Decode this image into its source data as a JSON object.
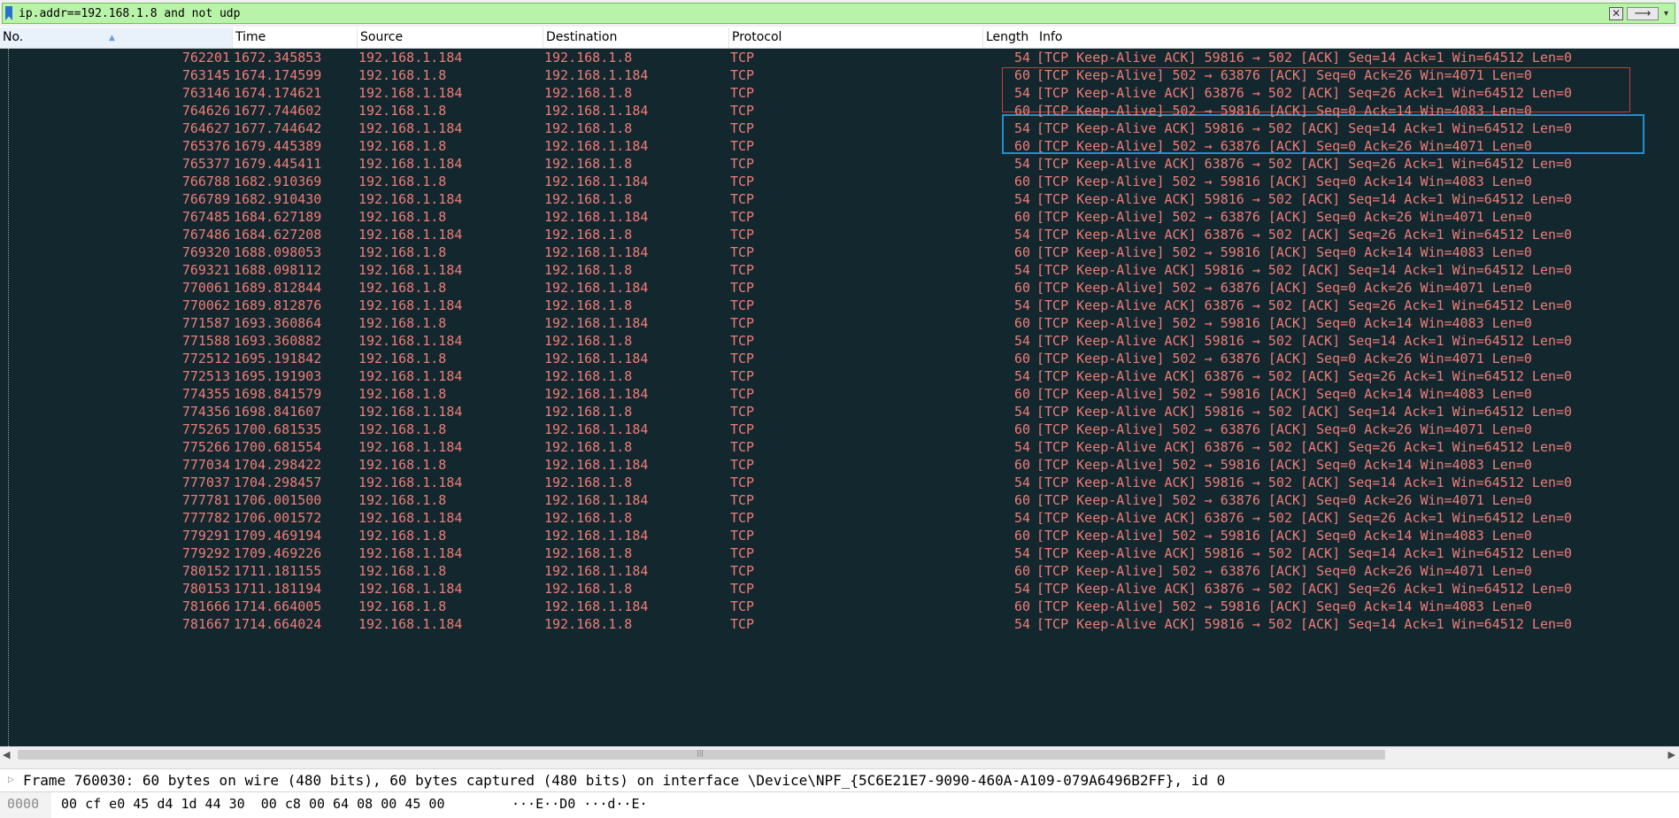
{
  "filter": {
    "value": "ip.addr==192.168.1.8 and not udp"
  },
  "columns": {
    "no": "No.",
    "time": "Time",
    "source": "Source",
    "destination": "Destination",
    "protocol": "Protocol",
    "length": "Length",
    "info": "Info"
  },
  "packets": [
    {
      "no": "762201",
      "time": "1672.345853",
      "source": "192.168.1.184",
      "destination": "192.168.1.8",
      "protocol": "TCP",
      "length": "54",
      "info": "[TCP Keep-Alive ACK] 59816 → 502 [ACK] Seq=14 Ack=1 Win=64512 Len=0"
    },
    {
      "no": "763145",
      "time": "1674.174599",
      "source": "192.168.1.8",
      "destination": "192.168.1.184",
      "protocol": "TCP",
      "length": "60",
      "info": "[TCP Keep-Alive] 502 → 63876 [ACK] Seq=0 Ack=26 Win=4071 Len=0"
    },
    {
      "no": "763146",
      "time": "1674.174621",
      "source": "192.168.1.184",
      "destination": "192.168.1.8",
      "protocol": "TCP",
      "length": "54",
      "info": "[TCP Keep-Alive ACK] 63876 → 502 [ACK] Seq=26 Ack=1 Win=64512 Len=0"
    },
    {
      "no": "764626",
      "time": "1677.744602",
      "source": "192.168.1.8",
      "destination": "192.168.1.184",
      "protocol": "TCP",
      "length": "60",
      "info": "[TCP Keep-Alive] 502 → 59816 [ACK] Seq=0 Ack=14 Win=4083 Len=0"
    },
    {
      "no": "764627",
      "time": "1677.744642",
      "source": "192.168.1.184",
      "destination": "192.168.1.8",
      "protocol": "TCP",
      "length": "54",
      "info": "[TCP Keep-Alive ACK] 59816 → 502 [ACK] Seq=14 Ack=1 Win=64512 Len=0"
    },
    {
      "no": "765376",
      "time": "1679.445389",
      "source": "192.168.1.8",
      "destination": "192.168.1.184",
      "protocol": "TCP",
      "length": "60",
      "info": "[TCP Keep-Alive] 502 → 63876 [ACK] Seq=0 Ack=26 Win=4071 Len=0"
    },
    {
      "no": "765377",
      "time": "1679.445411",
      "source": "192.168.1.184",
      "destination": "192.168.1.8",
      "protocol": "TCP",
      "length": "54",
      "info": "[TCP Keep-Alive ACK] 63876 → 502 [ACK] Seq=26 Ack=1 Win=64512 Len=0"
    },
    {
      "no": "766788",
      "time": "1682.910369",
      "source": "192.168.1.8",
      "destination": "192.168.1.184",
      "protocol": "TCP",
      "length": "60",
      "info": "[TCP Keep-Alive] 502 → 59816 [ACK] Seq=0 Ack=14 Win=4083 Len=0"
    },
    {
      "no": "766789",
      "time": "1682.910430",
      "source": "192.168.1.184",
      "destination": "192.168.1.8",
      "protocol": "TCP",
      "length": "54",
      "info": "[TCP Keep-Alive ACK] 59816 → 502 [ACK] Seq=14 Ack=1 Win=64512 Len=0"
    },
    {
      "no": "767485",
      "time": "1684.627189",
      "source": "192.168.1.8",
      "destination": "192.168.1.184",
      "protocol": "TCP",
      "length": "60",
      "info": "[TCP Keep-Alive] 502 → 63876 [ACK] Seq=0 Ack=26 Win=4071 Len=0"
    },
    {
      "no": "767486",
      "time": "1684.627208",
      "source": "192.168.1.184",
      "destination": "192.168.1.8",
      "protocol": "TCP",
      "length": "54",
      "info": "[TCP Keep-Alive ACK] 63876 → 502 [ACK] Seq=26 Ack=1 Win=64512 Len=0"
    },
    {
      "no": "769320",
      "time": "1688.098053",
      "source": "192.168.1.8",
      "destination": "192.168.1.184",
      "protocol": "TCP",
      "length": "60",
      "info": "[TCP Keep-Alive] 502 → 59816 [ACK] Seq=0 Ack=14 Win=4083 Len=0"
    },
    {
      "no": "769321",
      "time": "1688.098112",
      "source": "192.168.1.184",
      "destination": "192.168.1.8",
      "protocol": "TCP",
      "length": "54",
      "info": "[TCP Keep-Alive ACK] 59816 → 502 [ACK] Seq=14 Ack=1 Win=64512 Len=0"
    },
    {
      "no": "770061",
      "time": "1689.812844",
      "source": "192.168.1.8",
      "destination": "192.168.1.184",
      "protocol": "TCP",
      "length": "60",
      "info": "[TCP Keep-Alive] 502 → 63876 [ACK] Seq=0 Ack=26 Win=4071 Len=0"
    },
    {
      "no": "770062",
      "time": "1689.812876",
      "source": "192.168.1.184",
      "destination": "192.168.1.8",
      "protocol": "TCP",
      "length": "54",
      "info": "[TCP Keep-Alive ACK] 63876 → 502 [ACK] Seq=26 Ack=1 Win=64512 Len=0"
    },
    {
      "no": "771587",
      "time": "1693.360864",
      "source": "192.168.1.8",
      "destination": "192.168.1.184",
      "protocol": "TCP",
      "length": "60",
      "info": "[TCP Keep-Alive] 502 → 59816 [ACK] Seq=0 Ack=14 Win=4083 Len=0"
    },
    {
      "no": "771588",
      "time": "1693.360882",
      "source": "192.168.1.184",
      "destination": "192.168.1.8",
      "protocol": "TCP",
      "length": "54",
      "info": "[TCP Keep-Alive ACK] 59816 → 502 [ACK] Seq=14 Ack=1 Win=64512 Len=0"
    },
    {
      "no": "772512",
      "time": "1695.191842",
      "source": "192.168.1.8",
      "destination": "192.168.1.184",
      "protocol": "TCP",
      "length": "60",
      "info": "[TCP Keep-Alive] 502 → 63876 [ACK] Seq=0 Ack=26 Win=4071 Len=0"
    },
    {
      "no": "772513",
      "time": "1695.191903",
      "source": "192.168.1.184",
      "destination": "192.168.1.8",
      "protocol": "TCP",
      "length": "54",
      "info": "[TCP Keep-Alive ACK] 63876 → 502 [ACK] Seq=26 Ack=1 Win=64512 Len=0"
    },
    {
      "no": "774355",
      "time": "1698.841579",
      "source": "192.168.1.8",
      "destination": "192.168.1.184",
      "protocol": "TCP",
      "length": "60",
      "info": "[TCP Keep-Alive] 502 → 59816 [ACK] Seq=0 Ack=14 Win=4083 Len=0"
    },
    {
      "no": "774356",
      "time": "1698.841607",
      "source": "192.168.1.184",
      "destination": "192.168.1.8",
      "protocol": "TCP",
      "length": "54",
      "info": "[TCP Keep-Alive ACK] 59816 → 502 [ACK] Seq=14 Ack=1 Win=64512 Len=0"
    },
    {
      "no": "775265",
      "time": "1700.681535",
      "source": "192.168.1.8",
      "destination": "192.168.1.184",
      "protocol": "TCP",
      "length": "60",
      "info": "[TCP Keep-Alive] 502 → 63876 [ACK] Seq=0 Ack=26 Win=4071 Len=0"
    },
    {
      "no": "775266",
      "time": "1700.681554",
      "source": "192.168.1.184",
      "destination": "192.168.1.8",
      "protocol": "TCP",
      "length": "54",
      "info": "[TCP Keep-Alive ACK] 63876 → 502 [ACK] Seq=26 Ack=1 Win=64512 Len=0"
    },
    {
      "no": "777034",
      "time": "1704.298422",
      "source": "192.168.1.8",
      "destination": "192.168.1.184",
      "protocol": "TCP",
      "length": "60",
      "info": "[TCP Keep-Alive] 502 → 59816 [ACK] Seq=0 Ack=14 Win=4083 Len=0"
    },
    {
      "no": "777037",
      "time": "1704.298457",
      "source": "192.168.1.184",
      "destination": "192.168.1.8",
      "protocol": "TCP",
      "length": "54",
      "info": "[TCP Keep-Alive ACK] 59816 → 502 [ACK] Seq=14 Ack=1 Win=64512 Len=0"
    },
    {
      "no": "777781",
      "time": "1706.001500",
      "source": "192.168.1.8",
      "destination": "192.168.1.184",
      "protocol": "TCP",
      "length": "60",
      "info": "[TCP Keep-Alive] 502 → 63876 [ACK] Seq=0 Ack=26 Win=4071 Len=0"
    },
    {
      "no": "777782",
      "time": "1706.001572",
      "source": "192.168.1.184",
      "destination": "192.168.1.8",
      "protocol": "TCP",
      "length": "54",
      "info": "[TCP Keep-Alive ACK] 63876 → 502 [ACK] Seq=26 Ack=1 Win=64512 Len=0"
    },
    {
      "no": "779291",
      "time": "1709.469194",
      "source": "192.168.1.8",
      "destination": "192.168.1.184",
      "protocol": "TCP",
      "length": "60",
      "info": "[TCP Keep-Alive] 502 → 59816 [ACK] Seq=0 Ack=14 Win=4083 Len=0"
    },
    {
      "no": "779292",
      "time": "1709.469226",
      "source": "192.168.1.184",
      "destination": "192.168.1.8",
      "protocol": "TCP",
      "length": "54",
      "info": "[TCP Keep-Alive ACK] 59816 → 502 [ACK] Seq=14 Ack=1 Win=64512 Len=0"
    },
    {
      "no": "780152",
      "time": "1711.181155",
      "source": "192.168.1.8",
      "destination": "192.168.1.184",
      "protocol": "TCP",
      "length": "60",
      "info": "[TCP Keep-Alive] 502 → 63876 [ACK] Seq=0 Ack=26 Win=4071 Len=0"
    },
    {
      "no": "780153",
      "time": "1711.181194",
      "source": "192.168.1.184",
      "destination": "192.168.1.8",
      "protocol": "TCP",
      "length": "54",
      "info": "[TCP Keep-Alive ACK] 63876 → 502 [ACK] Seq=26 Ack=1 Win=64512 Len=0"
    },
    {
      "no": "781666",
      "time": "1714.664005",
      "source": "192.168.1.8",
      "destination": "192.168.1.184",
      "protocol": "TCP",
      "length": "60",
      "info": "[TCP Keep-Alive] 502 → 59816 [ACK] Seq=0 Ack=14 Win=4083 Len=0"
    },
    {
      "no": "781667",
      "time": "1714.664024",
      "source": "192.168.1.184",
      "destination": "192.168.1.8",
      "protocol": "TCP",
      "length": "54",
      "info": "[TCP Keep-Alive ACK] 59816 → 502 [ACK] Seq=14 Ack=1 Win=64512 Len=0"
    }
  ],
  "details": {
    "frame_summary": "Frame 760030: 60 bytes on wire (480 bits), 60 bytes captured (480 bits) on interface \\Device\\NPF_{5C6E21E7-9090-460A-A109-079A6496B2FF}, id 0"
  },
  "bytes": {
    "offset": "0000",
    "hex": "00 cf e0 45 d4 1d 44 30  00 c8 00 64 08 00 45 00",
    "ascii": "···E··D0 ···d··E·"
  },
  "colors": {
    "packet_list_bg": "#12272e",
    "packet_text": "#ee7d78",
    "filter_valid_bg": "#b9f3a9",
    "red_highlight": "#d23a3a",
    "blue_highlight": "#1f8fd2"
  }
}
